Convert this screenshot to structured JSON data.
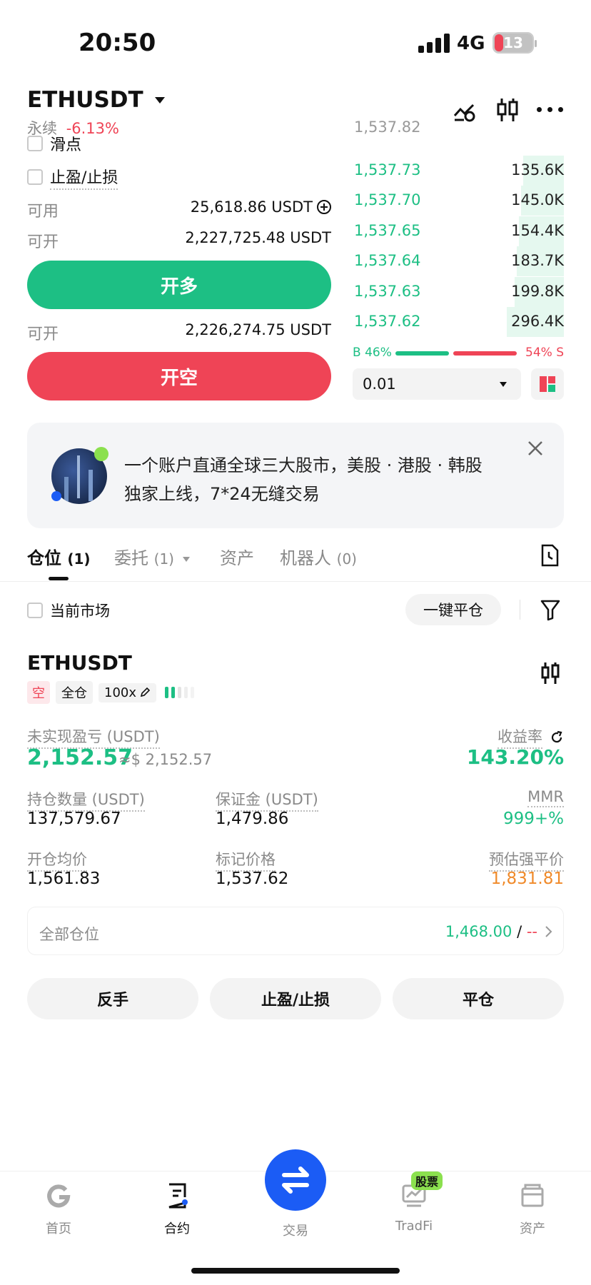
{
  "status_bar": {
    "time": "20:50",
    "network": "4G",
    "battery": "13"
  },
  "header": {
    "symbol": "ETHUSDT",
    "contract_type": "永续",
    "change": "-6.13%"
  },
  "order_form": {
    "slippage_label": "滑点",
    "tp_sl_label": "止盈/止损",
    "available_label": "可用",
    "available_value": "25,618.86 USDT",
    "open_label": "可开",
    "open_long_value": "2,227,725.48 USDT",
    "long_button": "开多",
    "open_short_value": "2,226,274.75 USDT",
    "short_button": "开空"
  },
  "orderbook": {
    "top_partial": "1,537.82",
    "rows": [
      {
        "price": "1,537.73",
        "qty": "135.6K",
        "depth": 0.19
      },
      {
        "price": "1,537.70",
        "qty": "145.0K",
        "depth": 0.2
      },
      {
        "price": "1,537.65",
        "qty": "154.4K",
        "depth": 0.21
      },
      {
        "price": "1,537.64",
        "qty": "183.7K",
        "depth": 0.22
      },
      {
        "price": "1,537.63",
        "qty": "199.8K",
        "depth": 0.23
      },
      {
        "price": "1,537.62",
        "qty": "296.4K",
        "depth": 0.27
      }
    ],
    "buy_ratio": "B 46%",
    "sell_ratio": "54% S",
    "buy_fraction": 0.46,
    "precision": "0.01"
  },
  "banner": {
    "line1": "一个账户直通全球三大股市，美股 · 港股 · 韩股",
    "line2": "独家上线，7*24无缝交易"
  },
  "tabs": [
    {
      "label": "仓位",
      "count": "(1)"
    },
    {
      "label": "委托",
      "count": "(1)"
    },
    {
      "label": "资产",
      "count": ""
    },
    {
      "label": "机器人",
      "count": "(0)"
    }
  ],
  "filter_row": {
    "current_market": "当前市场",
    "close_all": "一键平仓"
  },
  "position": {
    "symbol": "ETHUSDT",
    "side_tag": "空",
    "margin_mode": "全仓",
    "leverage": "100x",
    "unrealized_label": "未实现盈亏 (USDT)",
    "unrealized_value": "2,152.57",
    "unrealized_usd": "≈$ 2,152.57",
    "roe_label": "收益率",
    "roe_value": "143.20%",
    "size_label": "持仓数量 (USDT)",
    "size_value": "137,579.67",
    "margin_label": "保证金 (USDT)",
    "margin_value": "1,479.86",
    "mmr_label": "MMR",
    "mmr_value": "999+%",
    "entry_label": "开仓均价",
    "entry_value": "1,561.83",
    "mark_label": "标记价格",
    "mark_value": "1,537.62",
    "liq_label": "预估强平价",
    "liq_value": "1,831.81",
    "all_positions_label": "全部仓位",
    "all_positions_value": "1,468.00",
    "all_positions_sep": " / ",
    "all_positions_value2": "--",
    "btn_reverse": "反手",
    "btn_tpsl": "止盈/止损",
    "btn_close": "平仓"
  },
  "bottom_nav": [
    {
      "label": "首页",
      "icon": "home-icon"
    },
    {
      "label": "合约",
      "icon": "contract-icon"
    },
    {
      "label": "交易",
      "icon": "swap-icon"
    },
    {
      "label": "TradFi",
      "icon": "tradfi-icon",
      "badge": "股票"
    },
    {
      "label": "资产",
      "icon": "wallet-icon"
    }
  ],
  "colors": {
    "green": "#1dbf84",
    "red": "#ef4456",
    "blue": "#1b5cf5",
    "orange": "#f08a2a"
  }
}
